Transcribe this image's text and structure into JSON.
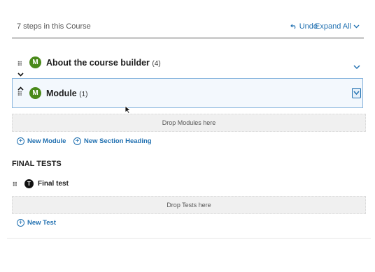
{
  "header": {
    "steps_text": "7 steps in this Course",
    "undo_label": "Undo",
    "expand_all_label": "Expand All"
  },
  "sections": [
    {
      "badge": "M",
      "title": "About the course builder",
      "count": "(4)"
    },
    {
      "badge": "M",
      "title": "Module",
      "count": "(1)"
    }
  ],
  "drop_modules": "Drop Modules here",
  "actions": {
    "new_module": "New Module",
    "new_section_heading": "New Section Heading"
  },
  "final_tests": {
    "heading": "FINAL TESTS",
    "test_badge": "T",
    "test_title": "Final test",
    "drop_tests": "Drop Tests here",
    "new_test": "New Test"
  },
  "colors": {
    "accent": "#2271b1",
    "module_badge": "#4a8a1a"
  }
}
